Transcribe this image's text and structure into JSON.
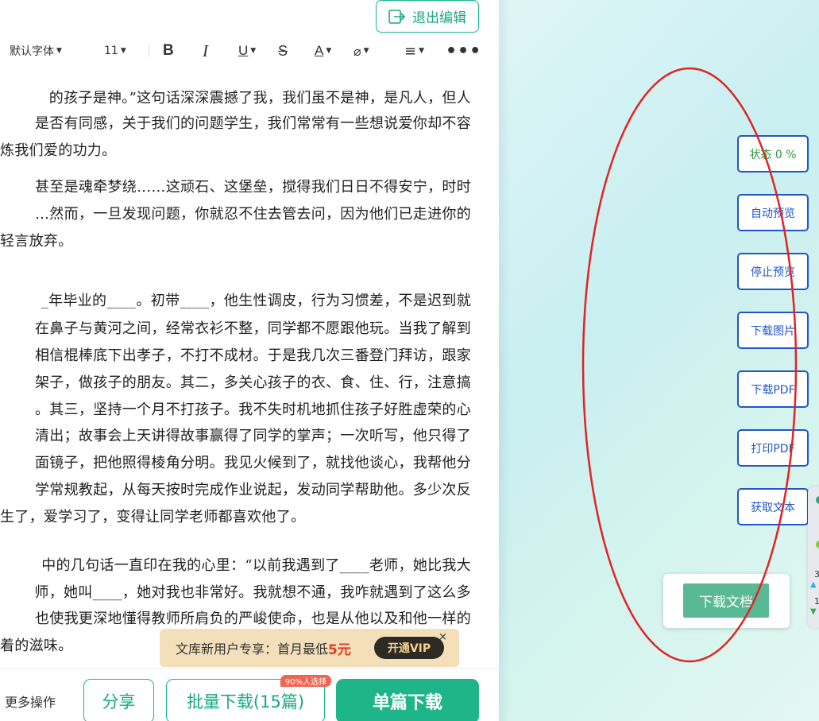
{
  "header": {
    "exit_edit_label": "退出编辑"
  },
  "toolbar": {
    "font_name": "默认字体",
    "font_size": "11",
    "bold": "B",
    "italic": "I",
    "underline": "U",
    "strike": "S",
    "font_color": "A",
    "highlight": "⌀",
    "align": "≡",
    "more": "•••"
  },
  "document": {
    "lines": [
      "的孩子是神。”这句话深深震撼了我，我们虽不是神，是凡人，但人",
      "是否有同感，关于我们的问题学生，我们常常有一些想说爱你却不容",
      "炼我们爱的功力。",
      "甚至是魂牵梦绕……这顽石、这堡垒，搅得我们日日不得安宁，时时",
      "…然而，一旦发现问题，你就忍不住去管去问，因为他们已走进你的",
      "轻言放弃。",
      "_年毕业的____。初带____，他生性调皮，行为习惯差，不是迟到就",
      "在鼻子与黄河之间，经常衣衫不整，同学都不愿跟他玩。当我了解到",
      "相信棍棒底下出孝子，不打不成材。于是我几次三番登门拜访，跟家",
      "架子，做孩子的朋友。其二，多关心孩子的衣、食、住、行，注意搞",
      "。其三，坚持一个月不打孩子。我不失时机地抓住孩子好胜虚荣的心",
      "清出；故事会上天讲得故事赢得了同学的掌声；一次听写，他只得了",
      "面镜子，把他照得棱角分明。我见火候到了，就找他谈心，我帮他分",
      "学常规教起，从每天按时完成作业说起，发动同学帮助他。多少次反",
      "生了，爱学习了，变得让同学老师都喜欢他了。",
      "中的几句话一直印在我的心里：“以前我遇到了____老师，她比我大",
      "师，她叫____，她对我也非常好。我就想不通，我咋就遇到了这么多",
      "也使我更深地懂得教师所肩负的严峻使命，也是从他以及和他一样的",
      "着的滋味。"
    ]
  },
  "vip_bar": {
    "text": "文库新用户专享：首月最低",
    "price": "5元",
    "button": "开通VIP",
    "close": "×"
  },
  "bottom": {
    "more_ops": "更多操作",
    "share": "分享",
    "batch_download": "批量下载(15篇)",
    "batch_badge": "90%人选择",
    "single_download": "单篇下载"
  },
  "side_buttons": {
    "status": "状态 0 %",
    "auto_preview": "自动预览",
    "stop_preview": "停止预览",
    "download_image": "下载图片",
    "download_pdf": "下载PDF",
    "print_pdf": "打印PDF",
    "get_text": "获取文本"
  },
  "doc_card": {
    "download_doc": "下载文档"
  },
  "edge_panel": {
    "num1": "3",
    "num2": "1"
  },
  "colors": {
    "accent": "#19b48f",
    "side_button": "#2156c9",
    "annotation": "#e02424"
  }
}
